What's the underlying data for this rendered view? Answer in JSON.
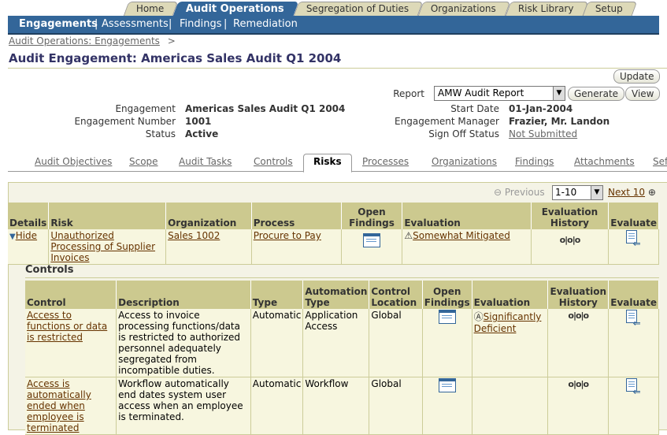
{
  "top_tabs": [
    {
      "label": "Home",
      "active": false
    },
    {
      "label": "Audit Operations",
      "active": true
    },
    {
      "label": "Segregation of Duties",
      "active": false
    },
    {
      "label": "Organizations",
      "active": false
    },
    {
      "label": "Risk Library",
      "active": false
    },
    {
      "label": "Setup",
      "active": false
    }
  ],
  "nav": {
    "items": [
      "Engagements",
      "Assessments",
      "Findings",
      "Remediation"
    ],
    "current": "Engagements"
  },
  "breadcrumb": {
    "link": "Audit Operations: Engagements",
    "sep": ">"
  },
  "page_title": "Audit Engagement: Americas Sales Audit Q1 2004",
  "update_label": "Update",
  "report": {
    "label": "Report",
    "selected": "AMW Audit Report",
    "generate": "Generate",
    "view": "View"
  },
  "summary": {
    "engagement_label": "Engagement",
    "engagement": "Americas Sales Audit Q1 2004",
    "number_label": "Engagement Number",
    "number": "1001",
    "status_label": "Status",
    "status": "Active",
    "start_label": "Start Date",
    "start": "01-Jan-2004",
    "manager_label": "Engagement Manager",
    "manager": "Frazier, Mr. Landon",
    "signoff_label": "Sign Off Status",
    "signoff": "Not Submitted"
  },
  "sub_tabs": [
    "Audit Objectives",
    "Scope",
    "Audit Tasks",
    "Controls",
    "Risks",
    "Processes",
    "Organizations",
    "Findings",
    "Attachments",
    "Sef"
  ],
  "sub_tab_active": "Risks",
  "pager": {
    "previous": "Previous",
    "range": "1-10",
    "next": "Next 10"
  },
  "risks_table": {
    "headers": {
      "details": "Details",
      "risk": "Risk",
      "organization": "Organization",
      "process": "Process",
      "open_findings": "Open Findings",
      "evaluation": "Evaluation",
      "eval_history": "Evaluation History",
      "evaluate": "Evaluate"
    },
    "row": {
      "details": "Hide",
      "risk": "Unauthorized Processing of Supplier Invoices",
      "organization": "Sales 1002",
      "process": "Procure to Pay",
      "evaluation": "Somewhat Mitigated"
    }
  },
  "controls": {
    "title": "Controls",
    "headers": {
      "control": "Control",
      "description": "Description",
      "type": "Type",
      "automation_type": "Automation Type",
      "location": "Control Location",
      "open_findings": "Open Findings",
      "evaluation": "Evaluation",
      "eval_history": "Evaluation History",
      "evaluate": "Evaluate"
    },
    "rows": [
      {
        "control": "Access to functions or data is restricted",
        "description": "Access to invoice processing functions/data is restricted to authorized personnel adequately segregated from incompatible duties.",
        "type": "Automatic",
        "automation_type": "Application Access",
        "location": "Global",
        "evaluation": "Significantly Deficient"
      },
      {
        "control": "Access is automatically ended when employee is terminated",
        "description": "Workflow automatically end dates system user access when an employee is terminated.",
        "type": "Automatic",
        "automation_type": "Workflow",
        "location": "Global",
        "evaluation": ""
      }
    ]
  },
  "icons": {
    "open_findings": "document-list-icon",
    "eval_history": "history-icon",
    "evaluate": "evaluate-icon",
    "warning": "warning-icon"
  },
  "colors": {
    "nav": "#336699",
    "header": "#ccc98f",
    "panel": "#f4f3e6",
    "link": "#663300"
  }
}
